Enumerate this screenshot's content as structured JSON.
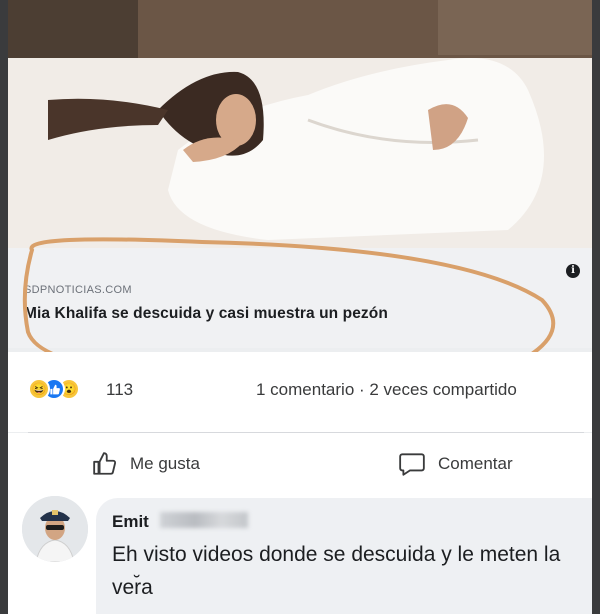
{
  "post": {
    "link": {
      "source": "SDPNOTICIAS.COM",
      "title": "Mia Khalifa se descuida y casi muestra un pezón",
      "info_icon": "info-icon"
    },
    "reactions": {
      "icons": [
        "haha-reaction-icon",
        "like-reaction-icon",
        "wow-reaction-icon"
      ],
      "count": "113"
    },
    "share_stats": "1 comentario · 2 veces compartido",
    "actions": {
      "like_label": "Me gusta",
      "comment_label": "Comentar"
    }
  },
  "comment": {
    "author": "Emit",
    "text": "Eh visto videos donde se descuida y le meten la ver̆a"
  },
  "colors": {
    "highlight_oval": "#d9a06a",
    "like_blue": "#1877f2",
    "reaction_yellow": "#f7c63c"
  }
}
